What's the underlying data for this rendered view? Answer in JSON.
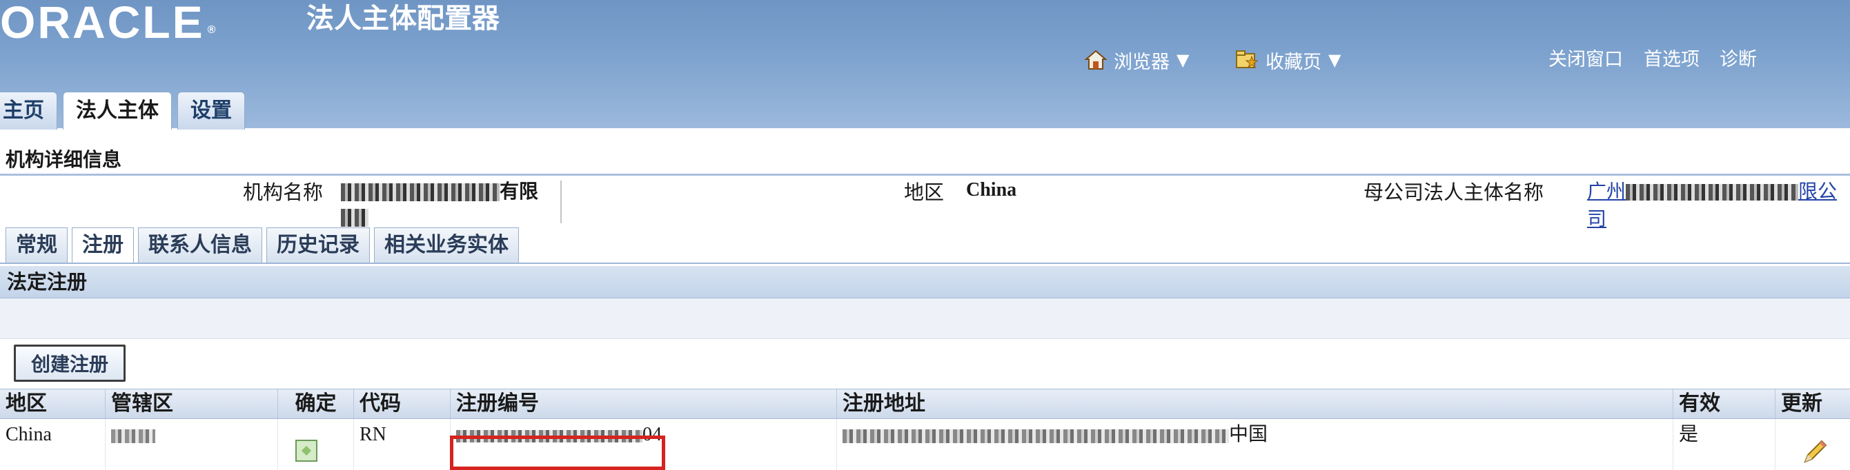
{
  "header": {
    "logo_text": "ORACLE",
    "logo_mark": "®",
    "app_title": "法人主体配置器",
    "global_nav": {
      "browser_label": "浏览器",
      "browser_icon": "home-icon",
      "favorites_label": "收藏页",
      "favorites_icon": "favorites-icon",
      "close_window": "关闭窗口",
      "preferences": "首选项",
      "diagnostics": "诊断"
    },
    "tabs": [
      {
        "label": "主页",
        "active": false
      },
      {
        "label": "法人主体",
        "active": true
      },
      {
        "label": "设置",
        "active": false
      }
    ]
  },
  "page": {
    "heading": "机构详细信息",
    "org_name_label": "机构名称",
    "org_name_value_suffix": "有限",
    "region_label": "地区",
    "region_value": "China",
    "parent_label": "母公司法人主体名称",
    "parent_value_prefix": "广州",
    "parent_value_mid": "限公",
    "parent_value_line2": "司"
  },
  "subtabs": [
    {
      "label": "常规",
      "active": false
    },
    {
      "label": "注册",
      "active": true
    },
    {
      "label": "联系人信息",
      "active": false
    },
    {
      "label": "历史记录",
      "active": false
    },
    {
      "label": "相关业务实体",
      "active": false
    }
  ],
  "section": {
    "title": "法定注册",
    "create_button": "创建注册"
  },
  "table": {
    "headers": [
      "地区",
      "管辖区",
      "确定",
      "代码",
      "注册编号",
      "注册地址",
      "有效",
      "更新"
    ],
    "rows": [
      {
        "region": "China",
        "jurisdiction": "C▯▯C",
        "code": "RN",
        "reg_number_end": "04",
        "address_end": "中国",
        "active": "是"
      }
    ]
  },
  "colors": {
    "header_blue": "#7ea3cf",
    "link_blue": "#2343a8",
    "highlight_red": "#d6231e"
  }
}
